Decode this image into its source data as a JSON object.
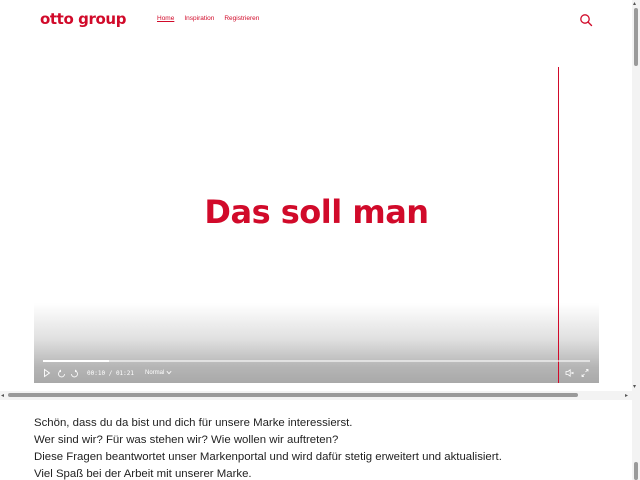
{
  "header": {
    "logo": "otto group",
    "nav": [
      {
        "label": "Home",
        "active": true
      },
      {
        "label": "Inspiration",
        "active": false
      },
      {
        "label": "Registrieren",
        "active": false
      }
    ],
    "search_icon": "search-icon"
  },
  "video": {
    "title": "Das soll man",
    "current_time": "00:10",
    "separator": "/",
    "duration": "01:21",
    "speed": "Normal",
    "progress_fraction": 0.12,
    "icons": [
      "play-icon",
      "rewind-icon",
      "forward-icon",
      "chevron-down-icon",
      "mute-icon",
      "fullscreen-icon"
    ]
  },
  "intro": {
    "lines": [
      "Schön, dass du da bist und dich für unsere Marke interessierst.",
      "Wer sind wir? Für was stehen wir? Wie wollen wir auftreten?",
      "Diese Fragen beantwortet unser Markenportal und wird dafür stetig erweitert und aktualisiert.",
      "Viel Spaß bei der Arbeit mit unserer Marke."
    ]
  },
  "colors": {
    "brand": "#d10a2a",
    "text": "#1f1f1f"
  }
}
